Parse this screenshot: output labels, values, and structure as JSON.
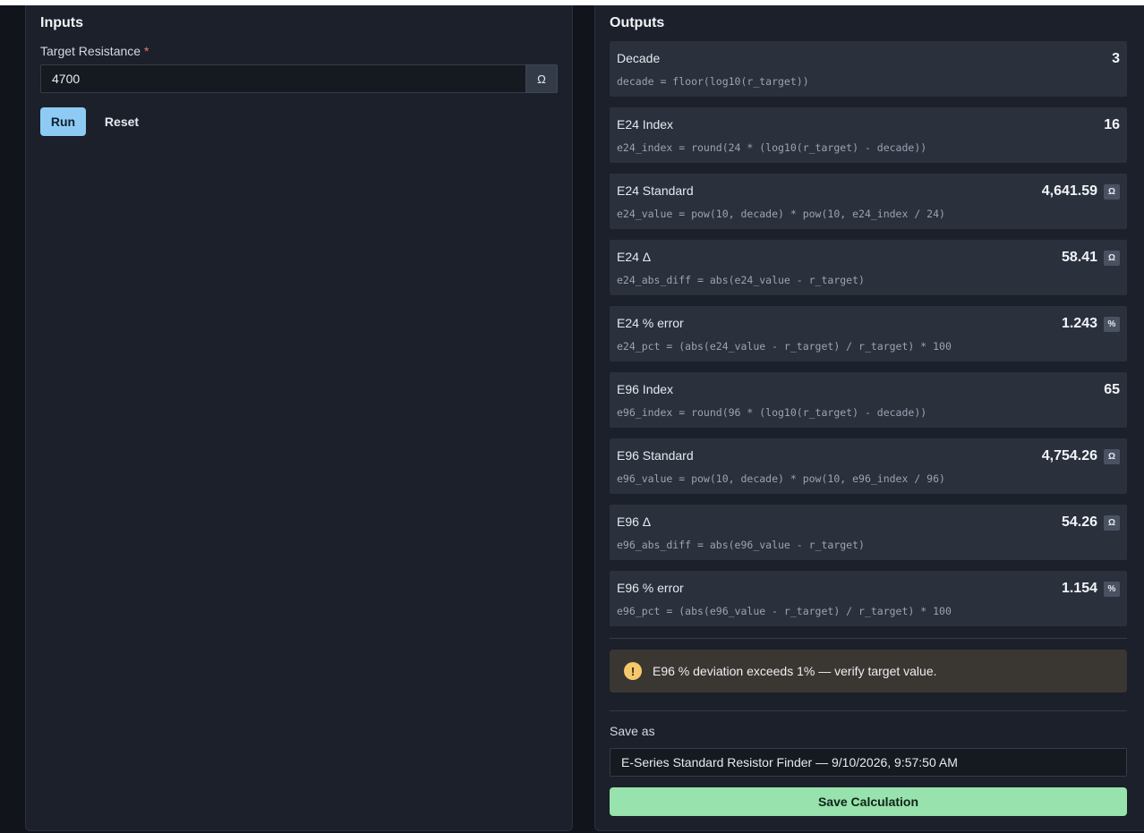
{
  "inputs": {
    "title": "Inputs",
    "target_label": "Target Resistance",
    "required_mark": "*",
    "target_value": "4700",
    "target_unit": "Ω",
    "run_label": "Run",
    "reset_label": "Reset"
  },
  "outputs": {
    "title": "Outputs",
    "items": [
      {
        "label": "Decade",
        "value": "3",
        "unit": "",
        "formula": "decade = floor(log10(r_target))"
      },
      {
        "label": "E24 Index",
        "value": "16",
        "unit": "",
        "formula": "e24_index = round(24 * (log10(r_target) - decade))"
      },
      {
        "label": "E24 Standard",
        "value": "4,641.59",
        "unit": "Ω",
        "formula": "e24_value = pow(10, decade) * pow(10, e24_index / 24)"
      },
      {
        "label": "E24 Δ",
        "value": "58.41",
        "unit": "Ω",
        "formula": "e24_abs_diff = abs(e24_value - r_target)"
      },
      {
        "label": "E24 % error",
        "value": "1.243",
        "unit": "%",
        "formula": "e24_pct = (abs(e24_value - r_target) / r_target) * 100"
      },
      {
        "label": "E96 Index",
        "value": "65",
        "unit": "",
        "formula": "e96_index = round(96 * (log10(r_target) - decade))"
      },
      {
        "label": "E96 Standard",
        "value": "4,754.26",
        "unit": "Ω",
        "formula": "e96_value = pow(10, decade) * pow(10, e96_index / 96)"
      },
      {
        "label": "E96 Δ",
        "value": "54.26",
        "unit": "Ω",
        "formula": "e96_abs_diff = abs(e96_value - r_target)"
      },
      {
        "label": "E96 % error",
        "value": "1.154",
        "unit": "%",
        "formula": "e96_pct = (abs(e96_value - r_target) / r_target) * 100"
      }
    ],
    "warning_icon": "!",
    "warning_text": "E96 % deviation exceeds 1% — verify target value.",
    "save_label": "Save as",
    "save_value": "E-Series Standard Resistor Finder — 9/10/2026, 9:57:50 AM",
    "save_button_label": "Save Calculation"
  },
  "colors": {
    "run_button": "#8ecbf4",
    "save_button": "#98e2ad",
    "warning_icon": "#f6c86a",
    "required": "#f07178"
  }
}
